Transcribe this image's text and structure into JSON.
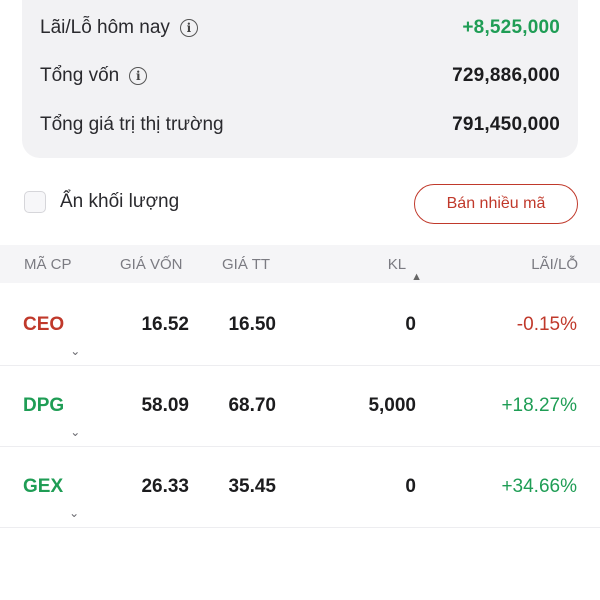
{
  "summary": {
    "pl_today_label": "Lãi/Lỗ hôm nay",
    "pl_today_value": "+8,525,000",
    "capital_label": "Tổng vốn",
    "capital_value": "729,886,000",
    "market_value_label": "Tổng giá trị thị trường",
    "market_value_value": "791,450,000"
  },
  "controls": {
    "hide_volume_label": "Ẩn khối lượng",
    "hide_volume_checked": false,
    "sell_multiple_label": "Bán nhiều mã"
  },
  "table": {
    "headers": {
      "code": "MÃ CP",
      "cost": "GIÁ VỐN",
      "price": "GIÁ TT",
      "qty": "KL",
      "pl": "LÃI/LỖ"
    },
    "rows": [
      {
        "code": "CEO",
        "cost": "16.52",
        "price": "16.50",
        "qty": "0",
        "pl": "-0.15%",
        "trend": "down"
      },
      {
        "code": "DPG",
        "cost": "58.09",
        "price": "68.70",
        "qty": "5,000",
        "pl": "+18.27%",
        "trend": "up"
      },
      {
        "code": "GEX",
        "cost": "26.33",
        "price": "35.45",
        "qty": "0",
        "pl": "+34.66%",
        "trend": "up"
      }
    ]
  },
  "colors": {
    "up": "#1f9d55",
    "down": "#c0392b",
    "accent": "#c0392b"
  },
  "icons": {
    "info": "info-circle-icon",
    "chevron": "chevron-down-icon",
    "sort": "sort-icon"
  }
}
